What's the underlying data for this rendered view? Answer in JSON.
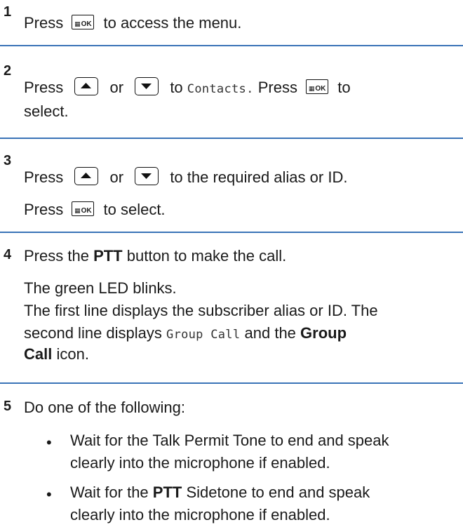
{
  "steps": {
    "s1": {
      "number": "1",
      "press": "Press",
      "ok_key_icon": "menu-ok-key-icon",
      "ok_label": "OK",
      "rest": "to access the menu."
    },
    "s2": {
      "number": "2",
      "press": "Press",
      "up_key_icon": "up-arrow-key-icon",
      "or": "or",
      "down_key_icon": "down-arrow-key-icon",
      "to": "to",
      "menu_item": "Contacts.",
      "press2": "Press",
      "ok_label": "OK",
      "to2": "to",
      "line2": "select."
    },
    "s3": {
      "number": "3",
      "press": "Press",
      "or": "or",
      "rest": "to the required alias or ID.",
      "press2": "Press",
      "ok_label": "OK",
      "rest2": "to select."
    },
    "s4": {
      "number": "4",
      "l1_a": "Press the",
      "l1_b": "PTT",
      "l1_c": "button to make the call.",
      "l2": "The green LED blinks.",
      "l3": "The first line displays the subscriber alias or ID. The",
      "l4_a": "second line displays",
      "l4_b": "Group Call",
      "l4_c": "and the",
      "l4_d": "Group",
      "l5_a": "Call",
      "l5_b": "icon."
    },
    "s5": {
      "number": "5",
      "intro": "Do one of the following:",
      "bullet_char": "•",
      "b1_l1": "Wait for the Talk Permit Tone to end and speak",
      "b1_l2": "clearly into the microphone if enabled.",
      "b2_l1_a": "Wait for the",
      "b2_l1_b": "PTT",
      "b2_l1_c": "Sidetone to end and speak",
      "b2_l2": "clearly into the microphone if enabled."
    }
  },
  "colors": {
    "rule": "#3a73b7",
    "text": "#1a1a1a"
  }
}
